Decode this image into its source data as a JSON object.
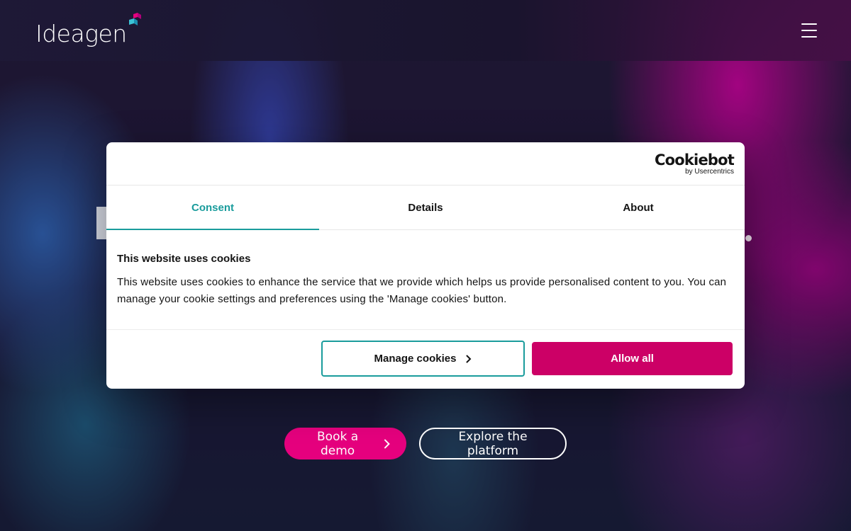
{
  "header": {
    "logo_text": "Ideagen",
    "menu_icon": "hamburger-menu-icon"
  },
  "hero": {
    "book_demo_label": "Book a demo",
    "explore_label": "Explore the platform"
  },
  "cookie_dialog": {
    "brand_name": "Cookiebot",
    "brand_sub": "by Usercentrics",
    "tabs": [
      {
        "label": "Consent",
        "active": true
      },
      {
        "label": "Details",
        "active": false
      },
      {
        "label": "About",
        "active": false
      }
    ],
    "title": "This website uses cookies",
    "text": "This website uses cookies to enhance the service that we provide which helps us provide personalised content to you. You can manage your cookie settings and preferences using the 'Manage cookies' button.",
    "manage_label": "Manage cookies",
    "allow_label": "Allow all"
  },
  "colors": {
    "accent_teal": "#1a9c9c",
    "allow_magenta": "#cc0066",
    "demo_pink": "#e6007e"
  }
}
